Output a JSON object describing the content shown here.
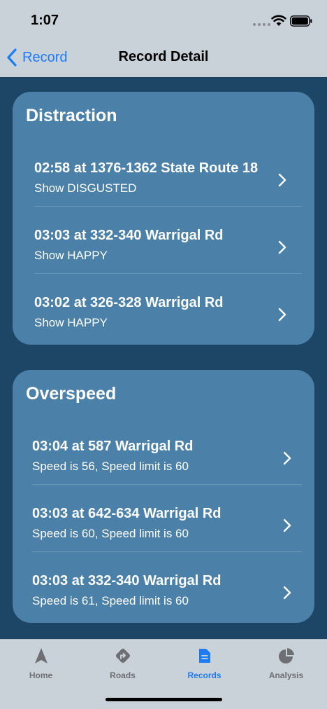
{
  "status": {
    "time": "1:07"
  },
  "nav": {
    "back_label": "Record",
    "title": "Record Detail"
  },
  "sections": [
    {
      "title": "Distraction",
      "rows": [
        {
          "title": "02:58 at 1376-1362 State Route 18",
          "subtitle": "Show DISGUSTED"
        },
        {
          "title": "03:03 at 332-340 Warrigal Rd",
          "subtitle": "Show HAPPY"
        },
        {
          "title": "03:02 at 326-328 Warrigal Rd",
          "subtitle": "Show HAPPY"
        }
      ]
    },
    {
      "title": "Overspeed",
      "rows": [
        {
          "title": "03:04 at 587 Warrigal Rd",
          "subtitle": "Speed is 56, Speed limit is 60"
        },
        {
          "title": "03:03 at 642-634 Warrigal Rd",
          "subtitle": "Speed is 60, Speed limit is 60"
        },
        {
          "title": "03:03 at 332-340 Warrigal Rd",
          "subtitle": "Speed is 61, Speed limit is 60"
        }
      ]
    }
  ],
  "tabs": [
    {
      "label": "Home",
      "icon": "location-arrow-icon",
      "active": false
    },
    {
      "label": "Roads",
      "icon": "road-sign-icon",
      "active": false
    },
    {
      "label": "Records",
      "icon": "document-icon",
      "active": true
    },
    {
      "label": "Analysis",
      "icon": "pie-chart-icon",
      "active": false
    }
  ],
  "colors": {
    "background": "#1d4566",
    "card": "#4b80a8",
    "bar": "#c9d1d9",
    "accent": "#1d7bf5",
    "inactive_tab": "#6d6f73"
  }
}
